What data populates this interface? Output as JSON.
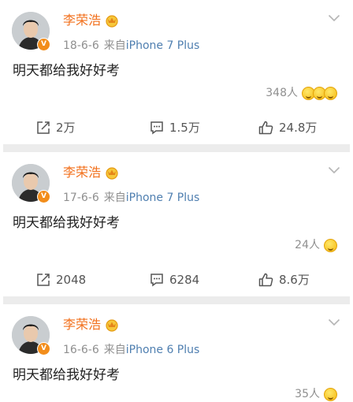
{
  "author": "李荣浩",
  "verified_badge": "V",
  "source_prefix": "来自",
  "posts": [
    {
      "date": "18-6-6",
      "device": "iPhone 7 Plus",
      "text": "明天都给我好好考",
      "likes_summary": "348人",
      "reposts": "2万",
      "comments": "1.5万",
      "likes": "24.8万"
    },
    {
      "date": "17-6-6",
      "device": "iPhone 7 Plus",
      "text": "明天都给我好好考",
      "likes_summary": "24人",
      "reposts": "2048",
      "comments": "6284",
      "likes": "8.6万"
    },
    {
      "date": "16-6-6",
      "device": "iPhone 6 Plus",
      "text": "明天都给我好好考",
      "likes_summary": "35人"
    }
  ],
  "colors": {
    "name": "#f2701c",
    "device_link": "#4f7fb0",
    "badge": "#f28d1b",
    "meta": "#8f8f8f",
    "divider": "#ececec"
  },
  "icons": {
    "repost": "repost-icon",
    "comment": "comment-icon",
    "like": "thumbs-up-icon",
    "menu": "chevron-down-icon",
    "crown": "crown-icon",
    "avatar": "avatar-icon"
  }
}
